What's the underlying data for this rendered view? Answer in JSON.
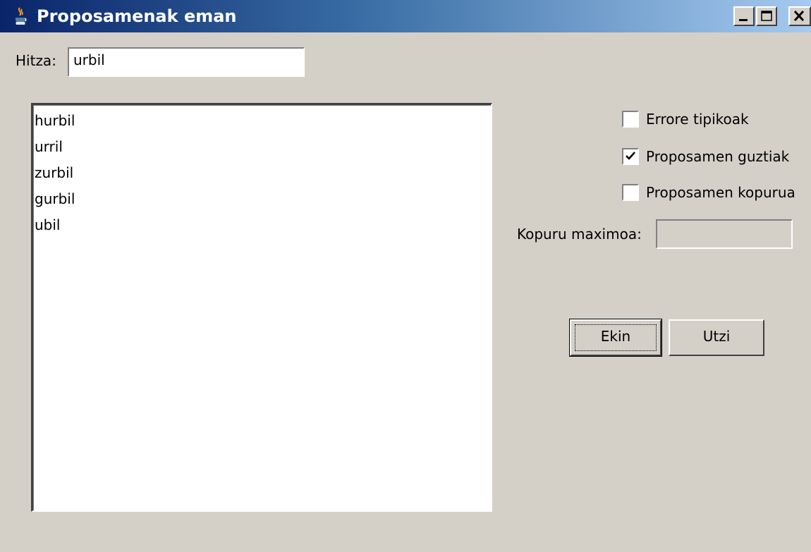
{
  "window": {
    "title": "Proposamenak eman",
    "icon": "java-coffee-icon",
    "controls": [
      "minimize-icon",
      "maximize-icon",
      "close-icon"
    ]
  },
  "word": {
    "label": "Hitza:",
    "value": "urbil"
  },
  "suggestions": [
    "hurbil",
    "urril",
    "zurbil",
    "gurbil",
    "ubil"
  ],
  "options": {
    "typical_errors": {
      "label": "Errore tipikoak",
      "checked": false
    },
    "all_suggestions": {
      "label": "Proposamen guztiak",
      "checked": true
    },
    "suggestion_size": {
      "label": "Proposamen kopurua",
      "checked": false
    }
  },
  "max_size": {
    "label": "Kopuru maximoa:",
    "value": ""
  },
  "buttons": {
    "ok": "Ekin",
    "cancel": "Utzi"
  },
  "colors": {
    "background": "#d4d0c8",
    "title_start": "#0a246a",
    "title_end": "#a6caf0"
  }
}
